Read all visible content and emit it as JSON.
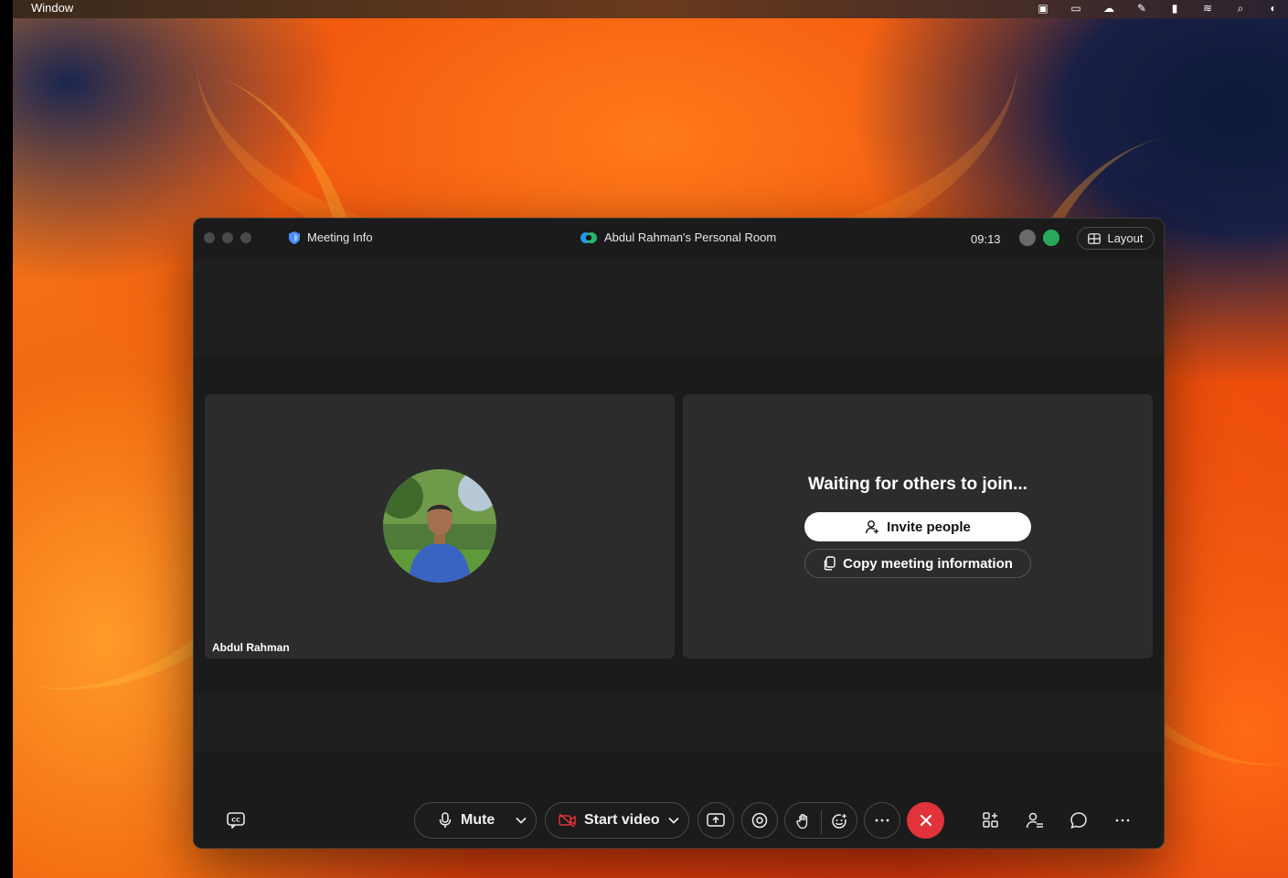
{
  "menubar": {
    "app_menu": "Window"
  },
  "window": {
    "meeting_info_label": "Meeting Info",
    "room_title": "Abdul Rahman's Personal Room",
    "clock": "09:13",
    "layout_label": "Layout"
  },
  "tiles": {
    "self_name": "Abdul Rahman",
    "waiting_text": "Waiting for others to join...",
    "invite_label": "Invite people",
    "copy_label": "Copy meeting information"
  },
  "controls": {
    "mute_label": "Mute",
    "video_label": "Start video"
  },
  "colors": {
    "end_call": "#e2323a",
    "window_bg": "#1b1b1b",
    "tile_bg": "#2c2c2c"
  }
}
